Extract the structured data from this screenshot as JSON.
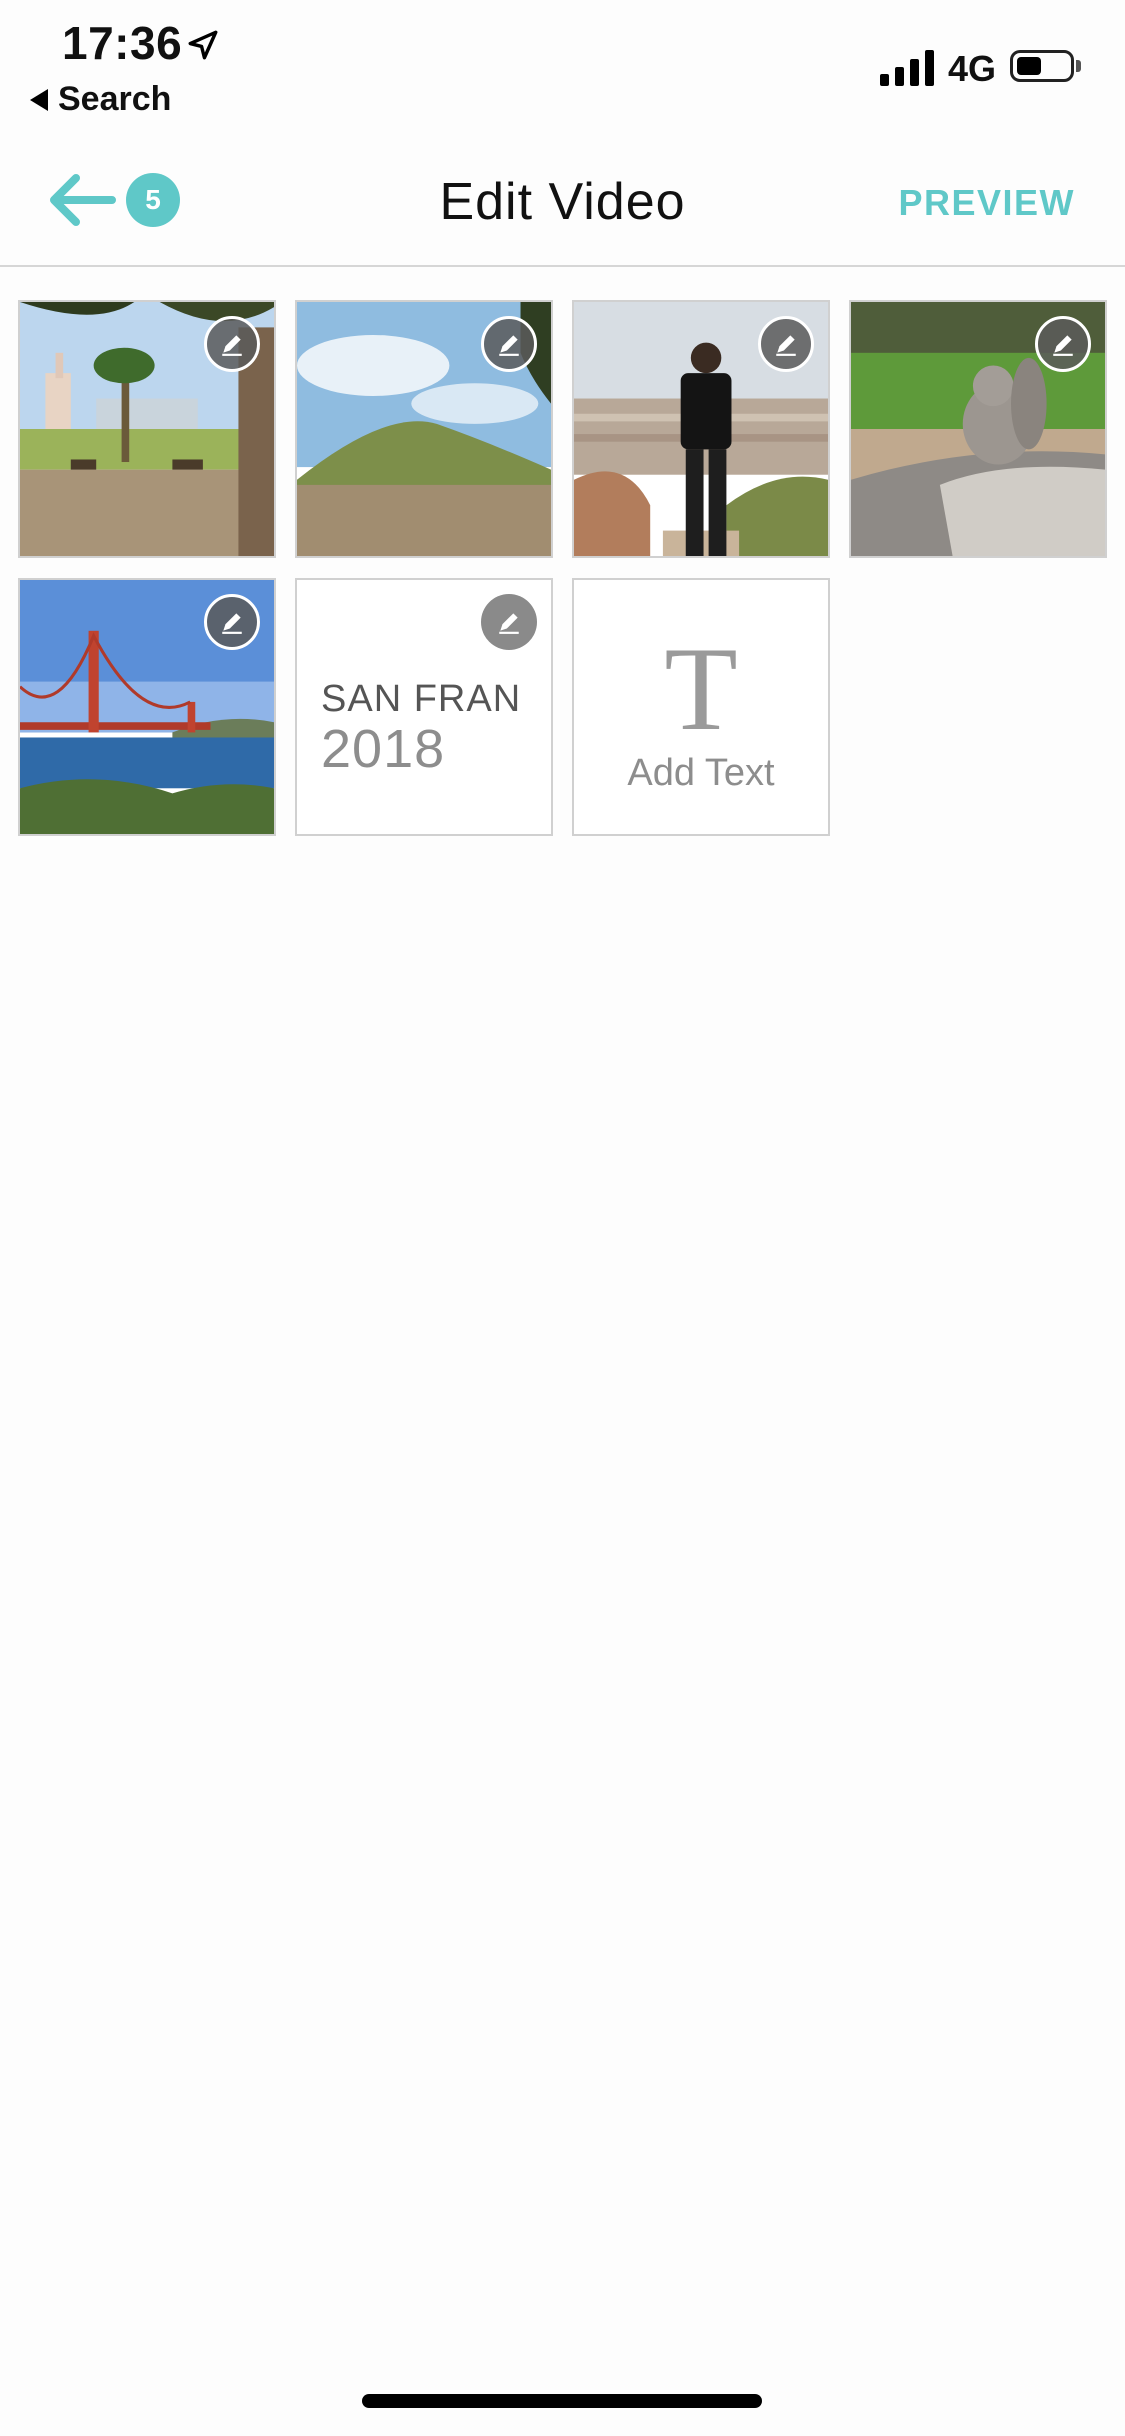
{
  "status_bar": {
    "time": "17:36",
    "back_label": "Search",
    "network": "4G"
  },
  "nav": {
    "title": "Edit Video",
    "count": "5",
    "preview_label": "PREVIEW",
    "accent_color": "#5fc8c8"
  },
  "tiles": [
    {
      "type": "photo",
      "scene": "park-with-palm-trees"
    },
    {
      "type": "photo",
      "scene": "grassy-hill-and-sky"
    },
    {
      "type": "photo",
      "scene": "man-overlooking-city"
    },
    {
      "type": "photo",
      "scene": "squirrel-on-log"
    },
    {
      "type": "photo",
      "scene": "golden-gate-bridge"
    },
    {
      "type": "title",
      "line1": "SAN FRAN",
      "line2": "2018"
    },
    {
      "type": "add-text",
      "glyph": "T",
      "label": "Add Text"
    }
  ]
}
